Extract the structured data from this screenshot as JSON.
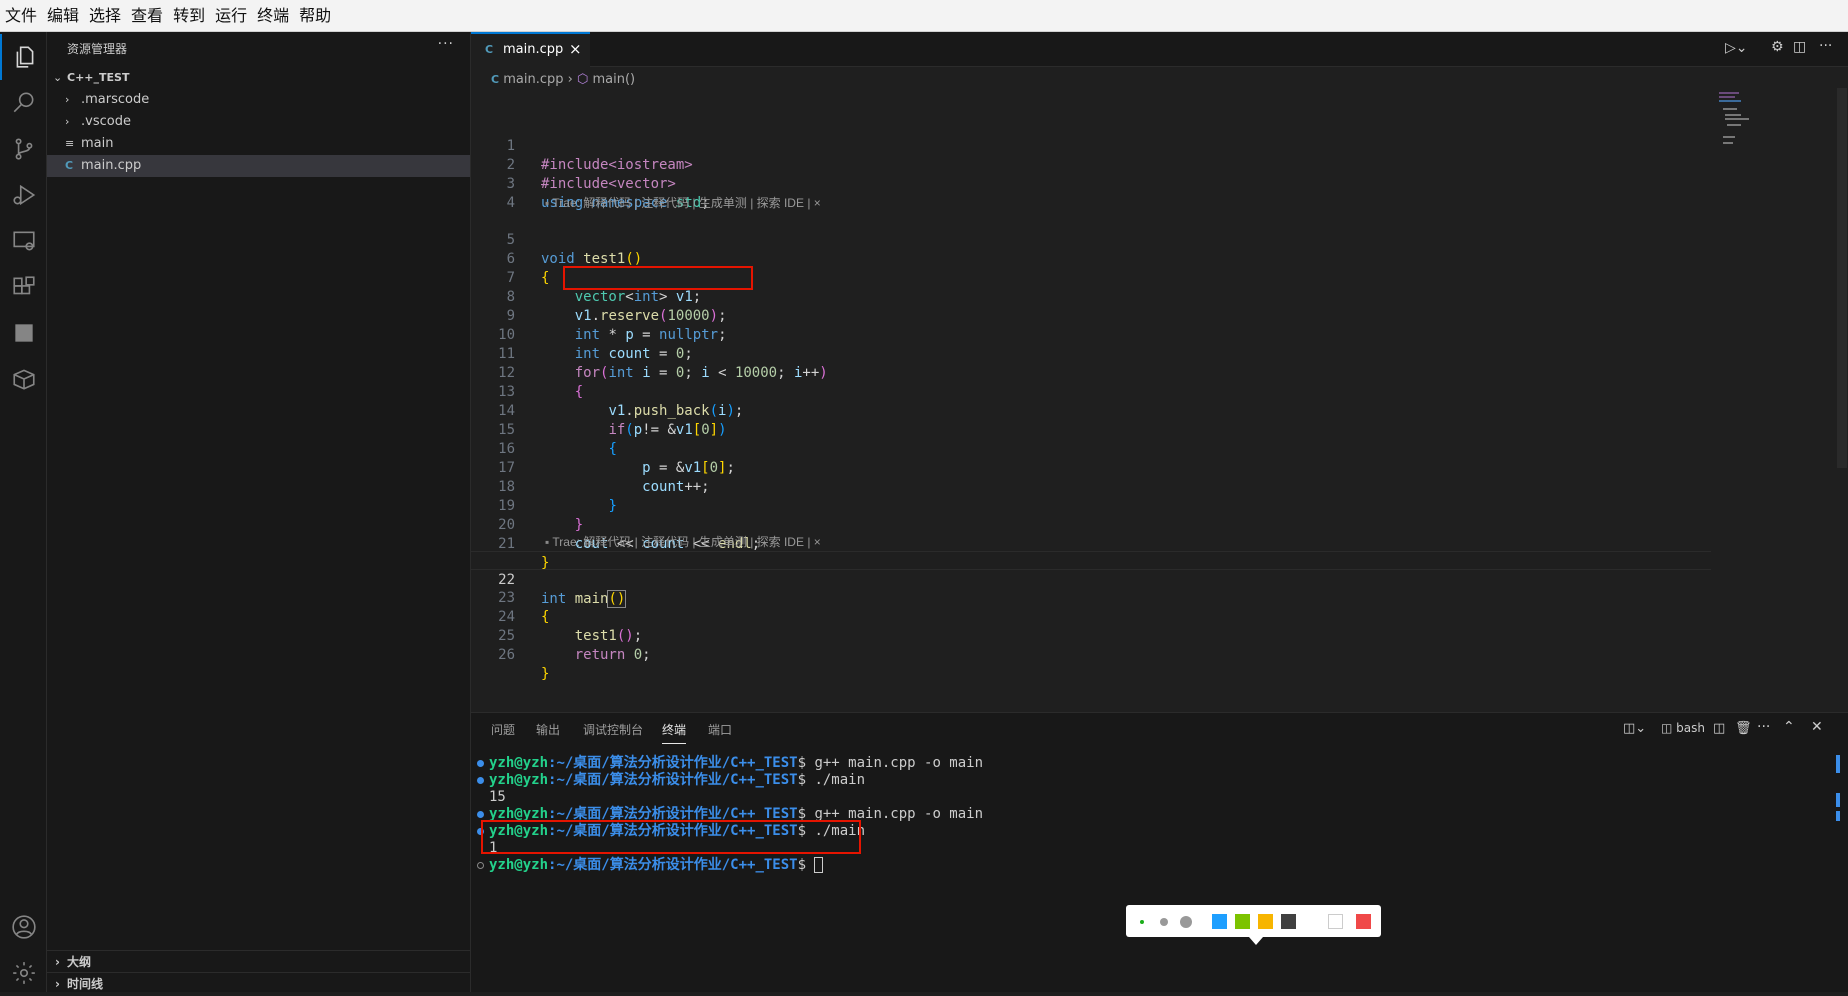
{
  "menu": [
    "文件",
    "编辑",
    "选择",
    "查看",
    "转到",
    "运行",
    "终端",
    "帮助"
  ],
  "explorer": {
    "title": "资源管理器",
    "more": "···",
    "root": "C++_TEST",
    "items": [
      ".marscode",
      ".vscode",
      "main",
      "main.cpp"
    ],
    "outline": "大纲",
    "timeline": "时间线"
  },
  "editor": {
    "tab_label": "main.cpp",
    "tab_close": "×",
    "breadcrumb_file": "main.cpp",
    "breadcrumb_symbol": "main()",
    "codelens": "Trae: 解释代码 | 注释代码 | 生成单测 | 探索 IDE | ×",
    "line_numbers": [
      "1",
      "2",
      "3",
      "4",
      "5",
      "6",
      "7",
      "8",
      "9",
      "10",
      "11",
      "12",
      "13",
      "14",
      "15",
      "16",
      "17",
      "18",
      "19",
      "20",
      "21",
      "22",
      "23",
      "24",
      "25",
      "26"
    ],
    "code": {
      "l1": "#include<iostream>",
      "l2": "#include<vector>",
      "l3_kw": "using",
      "l3_kw2": "namespace",
      "l3_ns": "std",
      "l5_kw": "void",
      "l5_fn": "test1",
      "l7_ty": "vector",
      "l7_kw": "int",
      "l7_var": "v1",
      "l8_var": "v1",
      "l8_fn": "reserve",
      "l8_num": "10000",
      "l9_kw": "int",
      "l9_var": "p",
      "l9_null": "nullptr",
      "l10_kw": "int",
      "l10_var": "count",
      "l10_num": "0",
      "l11_for": "for",
      "l11_kw": "int",
      "l11_var": "i",
      "l11_num0": "0",
      "l11_num": "10000",
      "l13_var": "v1",
      "l13_fn": "push_back",
      "l13_arg": "i",
      "l14_if": "if",
      "l14_var": "p",
      "l14_var2": "v1",
      "l14_num": "0",
      "l16_var": "p",
      "l16_var2": "v1",
      "l16_num": "0",
      "l17_var": "count",
      "l20_var": "cout",
      "l20_var2": "count",
      "l20_var3": "endl",
      "l22_kw": "int",
      "l22_fn": "main",
      "l24_fn": "test1",
      "l25_ret": "return",
      "l25_num": "0"
    }
  },
  "panel": {
    "tabs": [
      "问题",
      "输出",
      "调试控制台",
      "终端",
      "端口"
    ],
    "shell": "bash",
    "prompt_user": "yzh@yzh",
    "prompt_path": ":~/桌面/算法分析设计作业/C++_TEST",
    "lines": [
      {
        "cmd": "$ g++ main.cpp -o main"
      },
      {
        "cmd": "$ ./main"
      },
      {
        "out": "15"
      },
      {
        "cmd": "$ g++ main.cpp -o main"
      },
      {
        "cmd": "$ ./main"
      },
      {
        "out": "1"
      },
      {
        "cmd": "$ "
      }
    ]
  },
  "swatches": [
    "#1e9fff",
    "#7cc300",
    "#f7b500",
    "#404040",
    "#ffffff",
    "#f04848"
  ],
  "accent": "#0078d4"
}
